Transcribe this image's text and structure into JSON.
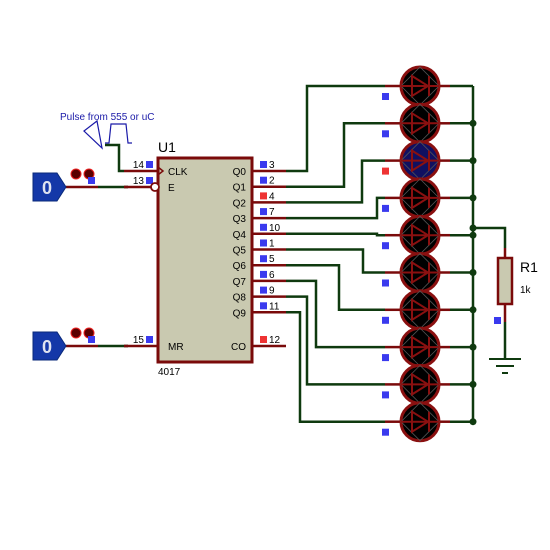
{
  "colors": {
    "wire": "#0f3a0f",
    "pin_wire": "#7a0a0a",
    "chip_fill": "#c9c9b0",
    "chip_border": "#7a0a0a",
    "logic_state_blue": "#1438a8",
    "pin_state_low": "#3a3aee",
    "pin_state_high": "#ee3333",
    "led_off": "#000000",
    "led_on": "#101060",
    "led_border": "#8a1010",
    "annotation": "#1a1aa8"
  },
  "annotation": {
    "pulse_note": "Pulse from 555 or uC"
  },
  "ic": {
    "ref": "U1",
    "part": "4017",
    "left_pins": [
      {
        "name": "CLK",
        "number": "14",
        "state": "low"
      },
      {
        "name": "E",
        "number": "13",
        "state": "low"
      },
      {
        "name": "MR",
        "number": "15",
        "state": "low"
      }
    ],
    "right_pins": [
      {
        "name": "Q0",
        "number": "3",
        "state": "low"
      },
      {
        "name": "Q1",
        "number": "2",
        "state": "low"
      },
      {
        "name": "Q2",
        "number": "4",
        "state": "high"
      },
      {
        "name": "Q3",
        "number": "7",
        "state": "low"
      },
      {
        "name": "Q4",
        "number": "10",
        "state": "low"
      },
      {
        "name": "Q5",
        "number": "1",
        "state": "low"
      },
      {
        "name": "Q6",
        "number": "5",
        "state": "low"
      },
      {
        "name": "Q7",
        "number": "6",
        "state": "low"
      },
      {
        "name": "Q8",
        "number": "9",
        "state": "low"
      },
      {
        "name": "Q9",
        "number": "11",
        "state": "low"
      },
      {
        "name": "CO",
        "number": "12",
        "state": "high"
      }
    ]
  },
  "logic_states": [
    {
      "id": "enable",
      "value": "0"
    },
    {
      "id": "reset",
      "value": "0"
    }
  ],
  "leds": [
    {
      "index": 0,
      "state": "off",
      "anode_state": "low"
    },
    {
      "index": 1,
      "state": "off",
      "anode_state": "low"
    },
    {
      "index": 2,
      "state": "on",
      "anode_state": "high"
    },
    {
      "index": 3,
      "state": "off",
      "anode_state": "low"
    },
    {
      "index": 4,
      "state": "off",
      "anode_state": "low"
    },
    {
      "index": 5,
      "state": "off",
      "anode_state": "low"
    },
    {
      "index": 6,
      "state": "off",
      "anode_state": "low"
    },
    {
      "index": 7,
      "state": "off",
      "anode_state": "low"
    },
    {
      "index": 8,
      "state": "off",
      "anode_state": "low"
    },
    {
      "index": 9,
      "state": "off",
      "anode_state": "low"
    }
  ],
  "resistor": {
    "ref": "R1",
    "value": "1k",
    "state": "low"
  }
}
